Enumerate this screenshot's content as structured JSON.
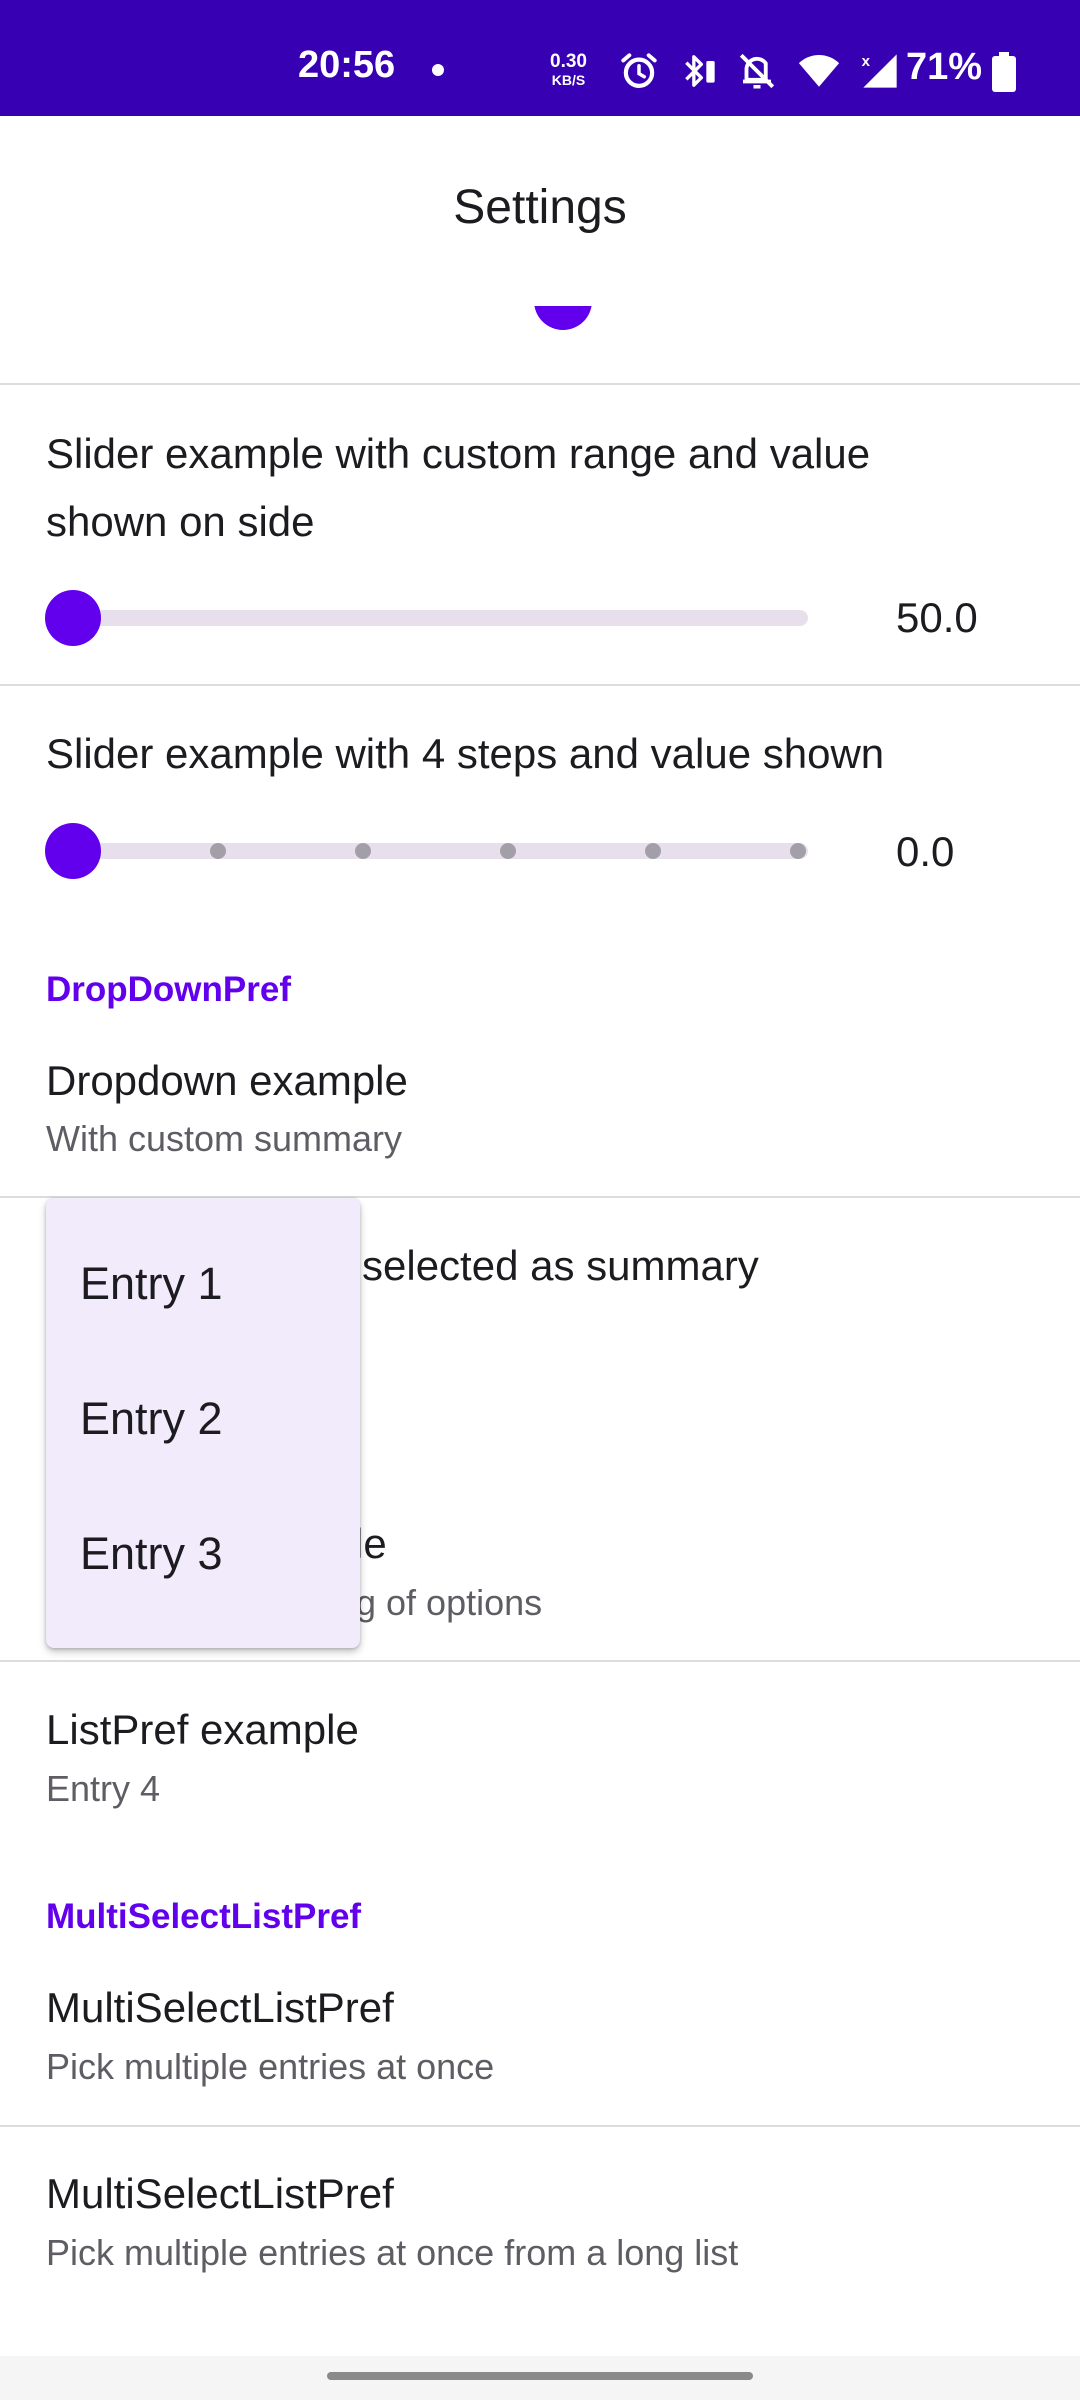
{
  "status_bar": {
    "time": "20:56",
    "net_speed_value": "0.30",
    "net_speed_unit": "KB/S",
    "battery_percent": "71%",
    "icons": [
      "alarm-icon",
      "bluetooth-battery-icon",
      "bell-off-icon",
      "wifi-icon",
      "signal-icon",
      "battery-icon"
    ]
  },
  "app_bar": {
    "title": "Settings"
  },
  "colors": {
    "accent": "#6200ee",
    "status_bar": "#3700b3",
    "menu_bg": "#f2ebfc",
    "track": "#e7e0ec"
  },
  "sliders": [
    {
      "title_line1": "Slider example with custom range and value",
      "title_line2": "shown on side",
      "value": "50.0",
      "position": 0.0
    },
    {
      "title": "Slider example with 4 steps and value shown",
      "value": "0.0",
      "position": 0.0,
      "ticks": 5
    }
  ],
  "dropdown_category": {
    "label": "DropDownPref"
  },
  "dropdown_example": {
    "title": "Dropdown example",
    "summary": "With custom summary"
  },
  "dropdown_selected": {
    "title_visible": "selected as summary"
  },
  "dropdown_long": {
    "title_visible": "le",
    "summary_visible": "g of options"
  },
  "dropdown_menu": {
    "items": [
      "Entry 1",
      "Entry 2",
      "Entry 3"
    ]
  },
  "list_pref": {
    "title": "ListPref example",
    "summary": "Entry 4"
  },
  "multi_category": {
    "label": "MultiSelectListPref"
  },
  "multi_pref_1": {
    "title": "MultiSelectListPref",
    "summary": "Pick multiple entries at once"
  },
  "multi_pref_2": {
    "title": "MultiSelectListPref",
    "summary": "Pick multiple entries at once from a long list"
  }
}
